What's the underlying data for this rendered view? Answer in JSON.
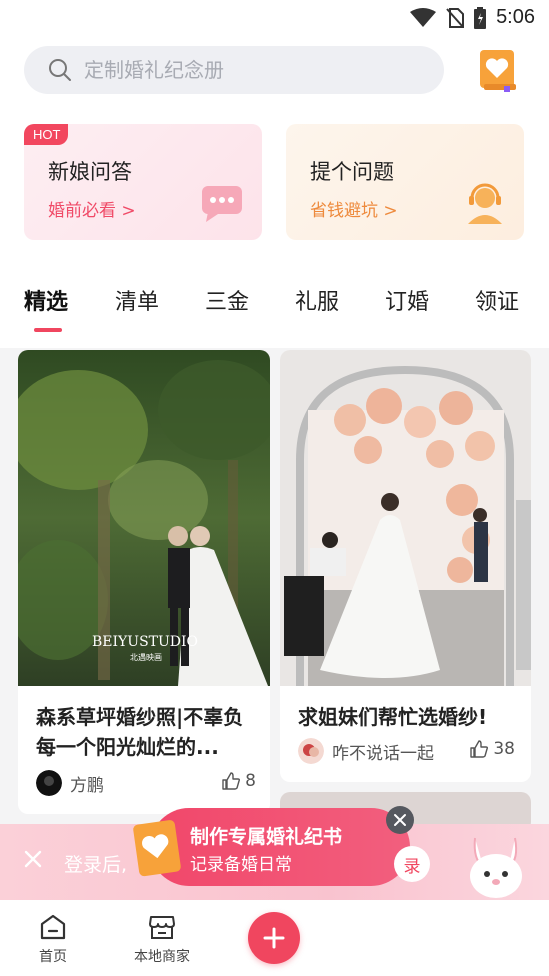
{
  "status_bar": {
    "time": "5:06"
  },
  "search": {
    "placeholder": "定制婚礼纪念册"
  },
  "cards": [
    {
      "badge": "HOT",
      "title": "新娘问答",
      "subtitle": "婚前必看 >"
    },
    {
      "title": "提个问题",
      "subtitle": "省钱避坑 >"
    }
  ],
  "tabs": [
    "精选",
    "清单",
    "三金",
    "礼服",
    "订婚",
    "领证"
  ],
  "active_tab": "精选",
  "feed": [
    {
      "title": "森系草坪婚纱照|不辜负每一个阳光灿烂的...",
      "photo_caption": "BEIYUSTUDIO",
      "photo_caption_sub": "北遇映画",
      "author": "方鹏",
      "likes": "8"
    },
    {
      "title": "求姐妹们帮忙选婚纱!",
      "author": "咋不说话一起",
      "likes": "38"
    }
  ],
  "login_banner": {
    "text": "登录后,",
    "login_label": "录"
  },
  "promo": {
    "title": "制作专属婚礼纪书",
    "subtitle": "记录备婚日常"
  },
  "bottom_nav": {
    "home": "首页",
    "local": "本地商家"
  },
  "colors": {
    "accent": "#f0465f",
    "hot_orange": "#ee8a3c"
  },
  "icons": [
    "wifi-icon",
    "no-sim-icon",
    "battery-icon",
    "search-icon",
    "album-book-icon",
    "chat-bubble-icon",
    "support-agent-icon",
    "thumb-up-icon",
    "close-icon",
    "home-icon",
    "store-icon",
    "plus-icon"
  ]
}
